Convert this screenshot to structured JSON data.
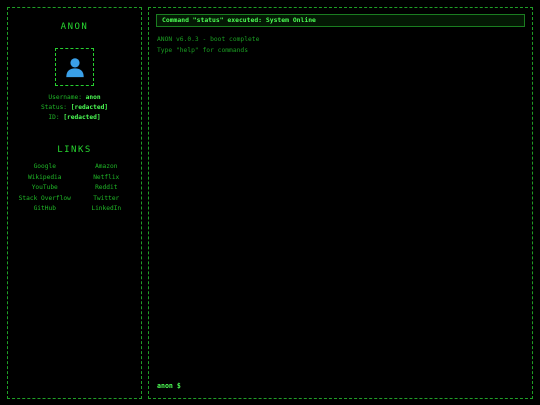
{
  "sidebar": {
    "title": "ANON",
    "avatar_icon": "user-silhouette-icon",
    "profile": [
      {
        "label": "Username:",
        "value": "anon"
      },
      {
        "label": "Status:",
        "value": "[redacted]"
      },
      {
        "label": "ID:",
        "value": "[redacted]"
      }
    ],
    "links_title": "LINKS",
    "links": [
      "Google",
      "Amazon",
      "Wikipedia",
      "Netflix",
      "YouTube",
      "Reddit",
      "Stack Overflow",
      "Twitter",
      "GitHub",
      "LinkedIn"
    ]
  },
  "terminal": {
    "command_message": "Command \"status\" executed: System Online",
    "output_lines": [
      "ANON v6.0.3 - boot complete",
      "Type \"help\" for commands"
    ],
    "prompt": "anon $",
    "input_value": ""
  },
  "colors": {
    "background": "#000000",
    "accent": "#4dff55",
    "text": "#1fb827",
    "border": "#1f9e26"
  }
}
